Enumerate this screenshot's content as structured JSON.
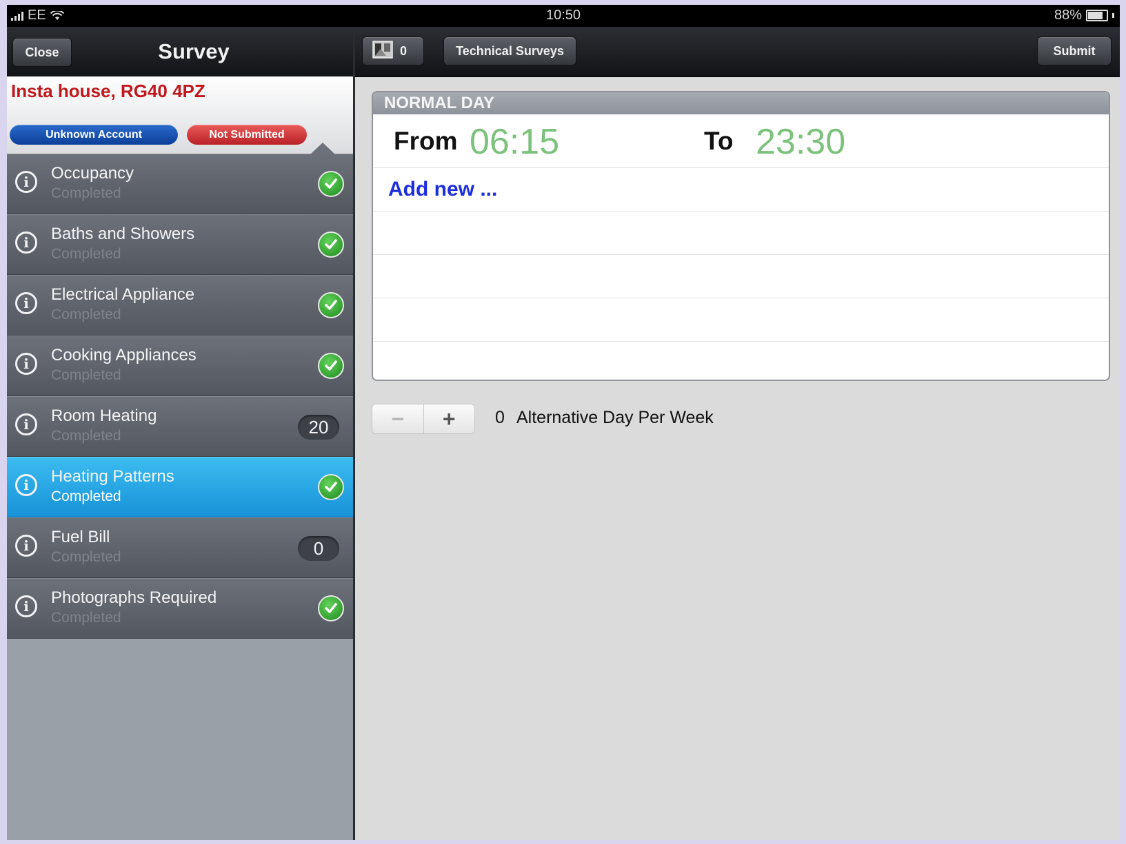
{
  "status_bar": {
    "carrier": "EE",
    "time": "10:50",
    "battery": "88%",
    "battery_level": 0.88
  },
  "left_nav": {
    "close_label": "Close",
    "title": "Survey"
  },
  "header": {
    "address": "Insta house, RG40 4PZ",
    "account_badge": "Unknown Account",
    "submission_badge": "Not Submitted",
    "account_color": "#1b55b8",
    "submission_color": "#d63a3d"
  },
  "sections": [
    {
      "title": "Occupancy",
      "status": "Completed",
      "indicator": "check"
    },
    {
      "title": "Baths and Showers",
      "status": "Completed",
      "indicator": "check"
    },
    {
      "title": "Electrical Appliance",
      "status": "Completed",
      "indicator": "check"
    },
    {
      "title": "Cooking Appliances",
      "status": "Completed",
      "indicator": "check"
    },
    {
      "title": "Room Heating",
      "status": "Completed",
      "indicator": "count",
      "count": "20"
    },
    {
      "title": "Heating Patterns",
      "status": "Completed",
      "indicator": "check",
      "selected": true
    },
    {
      "title": "Fuel Bill",
      "status": "Completed",
      "indicator": "count",
      "count": "0"
    },
    {
      "title": "Photographs Required",
      "status": "Completed",
      "indicator": "check"
    }
  ],
  "right_nav": {
    "photo_count": "0",
    "tech_label": "Technical Surveys",
    "submit_label": "Submit"
  },
  "normal_day": {
    "header": "NORMAL DAY",
    "from_label": "From",
    "from_time": "06:15",
    "to_label": "To",
    "to_time": "23:30",
    "add_new": "Add new ...",
    "time_color": "#7cc27c"
  },
  "stepper": {
    "minus": "−",
    "plus": "+",
    "value": "0",
    "label": "Alternative Day Per Week"
  },
  "colors": {
    "accent_selected": "#2aa8e6",
    "link": "#1d2fdd",
    "address": "#c0181c"
  }
}
